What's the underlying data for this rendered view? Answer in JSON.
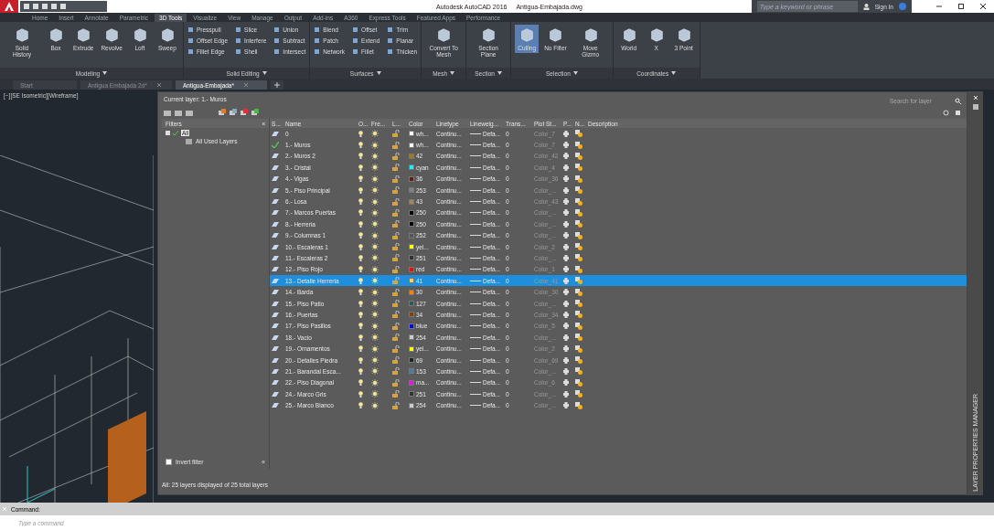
{
  "window": {
    "app_title": "Autodesk AutoCAD 2016",
    "file_title": "Antigua-Embajada.dwg",
    "search": {
      "placeholder": "Type a keyword or phrase"
    },
    "sign_in": "Sign In"
  },
  "ribbon_tabs": [
    {
      "label": "Home",
      "selected": false
    },
    {
      "label": "Insert",
      "selected": false
    },
    {
      "label": "Annotate",
      "selected": false
    },
    {
      "label": "Parametric",
      "selected": false
    },
    {
      "label": "3D Tools",
      "selected": true
    },
    {
      "label": "Visualize",
      "selected": false
    },
    {
      "label": "View",
      "selected": false
    },
    {
      "label": "Manage",
      "selected": false
    },
    {
      "label": "Output",
      "selected": false
    },
    {
      "label": "Add-ins",
      "selected": false
    },
    {
      "label": "A360",
      "selected": false
    },
    {
      "label": "Express Tools",
      "selected": false
    },
    {
      "label": "Featured Apps",
      "selected": false
    },
    {
      "label": "Performance",
      "selected": false
    }
  ],
  "ribbon_panels": [
    {
      "title": "Modeling",
      "large": [
        {
          "label": "Solid History",
          "active": false
        },
        {
          "label": "Box",
          "active": false
        },
        {
          "label": "Extrude",
          "active": false
        },
        {
          "label": "Revolve",
          "active": false
        },
        {
          "label": "Loft",
          "active": false
        },
        {
          "label": "Sweep",
          "active": false
        }
      ]
    },
    {
      "title": "Solid Editing",
      "small": [
        "Presspull",
        "Slice",
        "Union",
        "Offset Edge",
        "Interfere",
        "Subtract",
        "Fillet Edge",
        "Shell",
        "Intersect"
      ]
    },
    {
      "title": "Surfaces",
      "small": [
        "Blend",
        "Offset",
        "Trim",
        "Patch",
        "Extend",
        "Planar",
        "Network",
        "Fillet",
        "Thicken"
      ]
    },
    {
      "title": "Mesh",
      "large": [
        {
          "label": "Convert To Mesh",
          "active": false
        }
      ]
    },
    {
      "title": "Section",
      "large": [
        {
          "label": "Section Plane",
          "active": false
        }
      ]
    },
    {
      "title": "Selection",
      "large": [
        {
          "label": "Culling",
          "active": true
        },
        {
          "label": "No Filter",
          "active": false
        },
        {
          "label": "Move Gizmo",
          "active": false
        }
      ]
    },
    {
      "title": "Coordinates",
      "large": [
        {
          "label": "World",
          "active": false
        },
        {
          "label": "X",
          "active": false
        },
        {
          "label": "3 Point",
          "active": false
        }
      ]
    }
  ],
  "file_tabs": [
    {
      "label": "Start",
      "selected": false
    },
    {
      "label": "Antigua Embajada 2d*",
      "selected": false
    },
    {
      "label": "Antigua-Embajada*",
      "selected": true
    }
  ],
  "viewport": {
    "label": "[−][SE Isometric][Wireframe]"
  },
  "palette": {
    "title": "LAYER PROPERTIES MANAGER",
    "current_layer": "Current layer: 1.- Muros",
    "search": {
      "placeholder": "Search for layer"
    },
    "filters_header": "Filters",
    "filters": [
      {
        "label": "All",
        "selected": true,
        "children": [
          {
            "label": "All Used Layers",
            "selected": false
          }
        ]
      }
    ],
    "invert_filter": {
      "label": "Invert filter",
      "checked": false
    },
    "collapse": "«",
    "status": "All: 25 layers displayed of 25 total layers",
    "columns": [
      "S...",
      "Name",
      "O...",
      "Fre...",
      "L...",
      "Color",
      "Linetype",
      "Lineweig...",
      "Trans...",
      "Plot St...",
      "P...",
      "N...",
      "Description"
    ],
    "layers": [
      {
        "name": "0",
        "current": false,
        "color": "#ffffff",
        "color_label": "wh...",
        "linetype": "Continu...",
        "lineweight": "Defa...",
        "transparency": "0",
        "plot_style": "Color_7",
        "selected": false
      },
      {
        "name": "1.- Muros",
        "current": true,
        "color": "#ffffff",
        "color_label": "wh...",
        "linetype": "Continu...",
        "lineweight": "Defa...",
        "transparency": "0",
        "plot_style": "Color_7",
        "selected": false
      },
      {
        "name": "2.- Muros 2",
        "current": false,
        "color": "#a07a10",
        "color_label": "42",
        "linetype": "Continu...",
        "lineweight": "Defa...",
        "transparency": "0",
        "plot_style": "Color_42",
        "selected": false
      },
      {
        "name": "3.- Cristal",
        "current": false,
        "color": "#00ffff",
        "color_label": "cyan",
        "linetype": "Continu...",
        "lineweight": "Defa...",
        "transparency": "0",
        "plot_style": "Color_4",
        "selected": false
      },
      {
        "name": "4.- Vigas",
        "current": false,
        "color": "#5a2010",
        "color_label": "36",
        "linetype": "Continu...",
        "lineweight": "Defa...",
        "transparency": "0",
        "plot_style": "Color_36",
        "selected": false
      },
      {
        "name": "5.- Piso Principal",
        "current": false,
        "color": "#808080",
        "color_label": "253",
        "linetype": "Continu...",
        "lineweight": "Defa...",
        "transparency": "0",
        "plot_style": "Color_...",
        "selected": false
      },
      {
        "name": "6.- Losa",
        "current": false,
        "color": "#a08a50",
        "color_label": "43",
        "linetype": "Continu...",
        "lineweight": "Defa...",
        "transparency": "0",
        "plot_style": "Color_43",
        "selected": false
      },
      {
        "name": "7.- Marcos Puertas",
        "current": false,
        "color": "#000000",
        "color_label": "250",
        "linetype": "Continu...",
        "lineweight": "Defa...",
        "transparency": "0",
        "plot_style": "Color_...",
        "selected": false
      },
      {
        "name": "8.- Herreria",
        "current": false,
        "color": "#000000",
        "color_label": "250",
        "linetype": "Continu...",
        "lineweight": "Defa...",
        "transparency": "0",
        "plot_style": "Color_...",
        "selected": false
      },
      {
        "name": "9.- Columnas 1",
        "current": false,
        "color": "#555555",
        "color_label": "252",
        "linetype": "Continu...",
        "lineweight": "Defa...",
        "transparency": "0",
        "plot_style": "Color_...",
        "selected": false
      },
      {
        "name": "10.- Escaleras 1",
        "current": false,
        "color": "#ffff00",
        "color_label": "yel...",
        "linetype": "Continu...",
        "lineweight": "Defa...",
        "transparency": "0",
        "plot_style": "Color_2",
        "selected": false
      },
      {
        "name": "11.- Escaleras 2",
        "current": false,
        "color": "#333333",
        "color_label": "251",
        "linetype": "Continu...",
        "lineweight": "Defa...",
        "transparency": "0",
        "plot_style": "Color_...",
        "selected": false
      },
      {
        "name": "12.- Piso Rojo",
        "current": false,
        "color": "#ff0000",
        "color_label": "red",
        "linetype": "Continu...",
        "lineweight": "Defa...",
        "transparency": "0",
        "plot_style": "Color_1",
        "selected": false
      },
      {
        "name": "13.- Detalle Herreria",
        "current": false,
        "color": "#ffcc66",
        "color_label": "41",
        "linetype": "Continu...",
        "lineweight": "Defa...",
        "transparency": "0",
        "plot_style": "Color_41",
        "selected": true
      },
      {
        "name": "14.- Barda",
        "current": false,
        "color": "#ff8000",
        "color_label": "30",
        "linetype": "Continu...",
        "lineweight": "Defa...",
        "transparency": "0",
        "plot_style": "Color_30",
        "selected": false
      },
      {
        "name": "15.- Piso Patio",
        "current": false,
        "color": "#2a5a50",
        "color_label": "127",
        "linetype": "Continu...",
        "lineweight": "Defa...",
        "transparency": "0",
        "plot_style": "Color_...",
        "selected": false
      },
      {
        "name": "16.- Puertas",
        "current": false,
        "color": "#804000",
        "color_label": "34",
        "linetype": "Continu...",
        "lineweight": "Defa...",
        "transparency": "0",
        "plot_style": "Color_34",
        "selected": false
      },
      {
        "name": "17.- Piso Pasillos",
        "current": false,
        "color": "#0000ff",
        "color_label": "blue",
        "linetype": "Continu...",
        "lineweight": "Defa...",
        "transparency": "0",
        "plot_style": "Color_5",
        "selected": false
      },
      {
        "name": "18.- Vacio",
        "current": false,
        "color": "#cccccc",
        "color_label": "254",
        "linetype": "Continu...",
        "lineweight": "Defa...",
        "transparency": "0",
        "plot_style": "Color_...",
        "selected": false
      },
      {
        "name": "19.- Ornamentos",
        "current": false,
        "color": "#ffff00",
        "color_label": "yel...",
        "linetype": "Continu...",
        "lineweight": "Defa...",
        "transparency": "0",
        "plot_style": "Color_2",
        "selected": false
      },
      {
        "name": "20.- Detalles Piedra",
        "current": false,
        "color": "#1a2a1a",
        "color_label": "69",
        "linetype": "Continu...",
        "lineweight": "Defa...",
        "transparency": "0",
        "plot_style": "Color_69",
        "selected": false
      },
      {
        "name": "21.- Barandal Esca...",
        "current": false,
        "color": "#4a7aaa",
        "color_label": "153",
        "linetype": "Continu...",
        "lineweight": "Defa...",
        "transparency": "0",
        "plot_style": "Color_...",
        "selected": false
      },
      {
        "name": "22.- Piso Diagonal",
        "current": false,
        "color": "#ff00ff",
        "color_label": "ma...",
        "linetype": "Continu...",
        "lineweight": "Defa...",
        "transparency": "0",
        "plot_style": "Color_6",
        "selected": false
      },
      {
        "name": "24.- Marco Gris",
        "current": false,
        "color": "#333333",
        "color_label": "251",
        "linetype": "Continu...",
        "lineweight": "Defa...",
        "transparency": "0",
        "plot_style": "Color_...",
        "selected": false
      },
      {
        "name": "25.- Marco Blanco",
        "current": false,
        "color": "#cccccc",
        "color_label": "254",
        "linetype": "Continu...",
        "lineweight": "Defa...",
        "transparency": "0",
        "plot_style": "Color_...",
        "selected": false
      }
    ]
  },
  "command": {
    "label": "Command:",
    "placeholder": "Type a command"
  }
}
